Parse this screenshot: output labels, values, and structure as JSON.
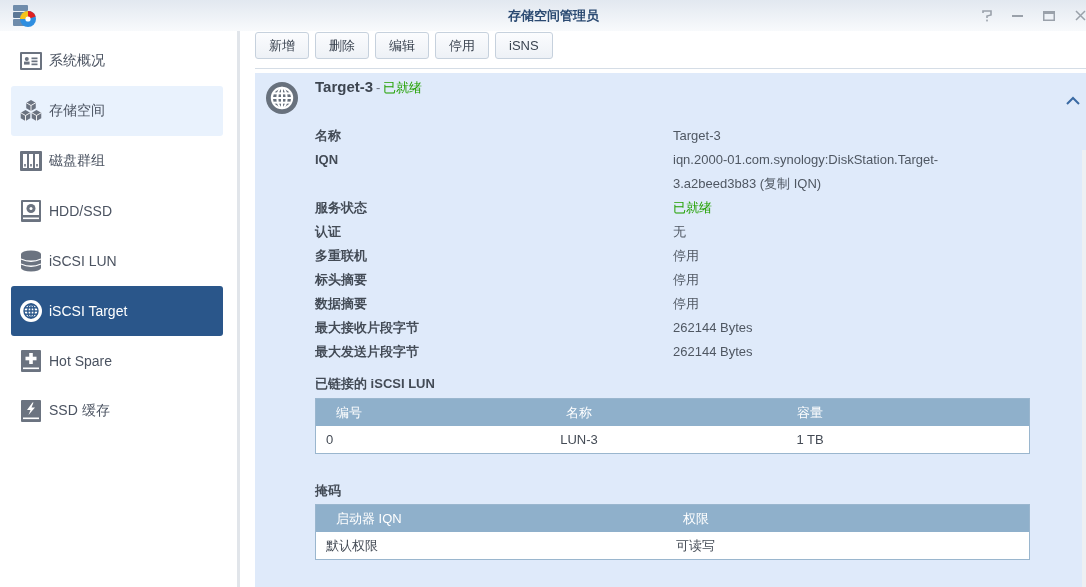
{
  "window": {
    "title": "存储空间管理员"
  },
  "sidebar": {
    "items": [
      {
        "label": "系统概况",
        "kind": "overview",
        "selected": false,
        "hovered": false
      },
      {
        "label": "存储空间",
        "kind": "volume",
        "selected": false,
        "hovered": true
      },
      {
        "label": "磁盘群组",
        "kind": "group",
        "selected": false,
        "hovered": false
      },
      {
        "label": "HDD/SSD",
        "kind": "drive",
        "selected": false,
        "hovered": false
      },
      {
        "label": "iSCSI LUN",
        "kind": "lun",
        "selected": false,
        "hovered": false
      },
      {
        "label": "iSCSI Target",
        "kind": "target",
        "selected": true,
        "hovered": false
      },
      {
        "label": "Hot Spare",
        "kind": "spare",
        "selected": false,
        "hovered": false
      },
      {
        "label": "SSD 缓存",
        "kind": "cache",
        "selected": false,
        "hovered": false
      }
    ]
  },
  "toolbar": {
    "buttons": [
      "新增",
      "删除",
      "编辑",
      "停用",
      "iSNS"
    ]
  },
  "target": {
    "name": "Target-3",
    "separator": "-",
    "status": "已就绪",
    "expanded": true,
    "properties": [
      {
        "label": "名称",
        "value": "Target-3",
        "kind": "text"
      },
      {
        "label": "IQN",
        "value": "iqn.2000-01.com.synology:DiskStation.Target-3.a2beed3b83",
        "link": "(复制 IQN)",
        "kind": "link"
      },
      {
        "label": "服务状态",
        "value": "已就绪",
        "kind": "status"
      },
      {
        "label": "认证",
        "value": "无",
        "kind": "text"
      },
      {
        "label": "多重联机",
        "value": "停用",
        "kind": "text"
      },
      {
        "label": "标头摘要",
        "value": "停用",
        "kind": "text"
      },
      {
        "label": "数据摘要",
        "value": "停用",
        "kind": "text"
      },
      {
        "label": "最大接收片段字节",
        "value": "262144 Bytes",
        "kind": "text"
      },
      {
        "label": "最大发送片段字节",
        "value": "262144 Bytes",
        "kind": "text"
      }
    ],
    "linked_luns": {
      "title": "已链接的 iSCSI LUN",
      "columns": [
        "编号",
        "名称",
        "容量"
      ],
      "rows": [
        [
          "0",
          "LUN-3",
          "1 TB"
        ]
      ]
    },
    "masking": {
      "title": "掩码",
      "columns": [
        "启动器 IQN",
        "权限"
      ],
      "rows": [
        [
          "默认权限",
          "可读写"
        ]
      ]
    }
  }
}
